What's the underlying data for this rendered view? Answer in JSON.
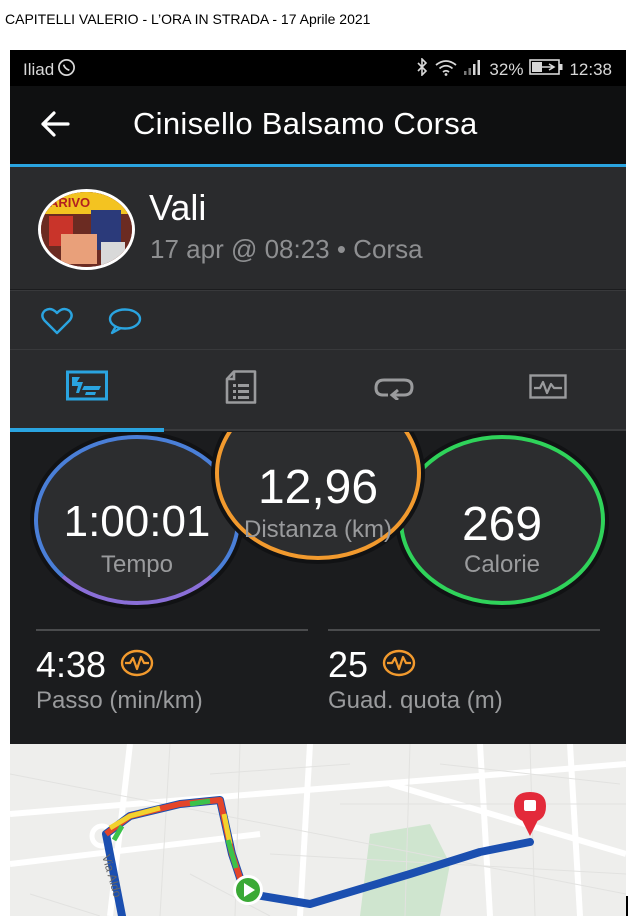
{
  "caption": "CAPITELLI VALERIO  -  L’ORA IN STRADA  -  17 Aprile 2021",
  "status_bar": {
    "carrier": "Iliad",
    "battery": "32%",
    "time": "12:38",
    "icons": [
      "whatsapp-icon",
      "bluetooth-icon",
      "wifi-icon",
      "signal-icon",
      "battery-icon"
    ]
  },
  "app_bar": {
    "back_icon": "arrow-left-icon",
    "title": "Cinisello Balsamo Corsa"
  },
  "activity": {
    "user_name": "Vali",
    "subtitle": "17 apr @ 08:23 • Corsa"
  },
  "social": {
    "icons": [
      "heart-icon",
      "comment-icon"
    ]
  },
  "tabs": {
    "items": [
      "summary-icon",
      "details-icon",
      "laps-icon",
      "charts-icon"
    ],
    "selected_index": 0
  },
  "stats": {
    "time_value": "1:00:01",
    "time_label": "Tempo",
    "distance_value": "12,96",
    "distance_label": "Distanza (km)",
    "calories_value": "269",
    "calories_label": "Calorie",
    "pace_value": "4:38",
    "pace_label": "Passo (min/km)",
    "elevation_value": "25",
    "elevation_label": "Guad. quota (m)"
  },
  "map": {
    "street_label": "Via Aldo"
  },
  "colors": {
    "accent": "#2aa4e0",
    "time_ring": "#4a7fd8",
    "distance_ring": "#f29a2e",
    "calories_ring": "#2fd35a",
    "pace_icon": "#f29a2e"
  }
}
